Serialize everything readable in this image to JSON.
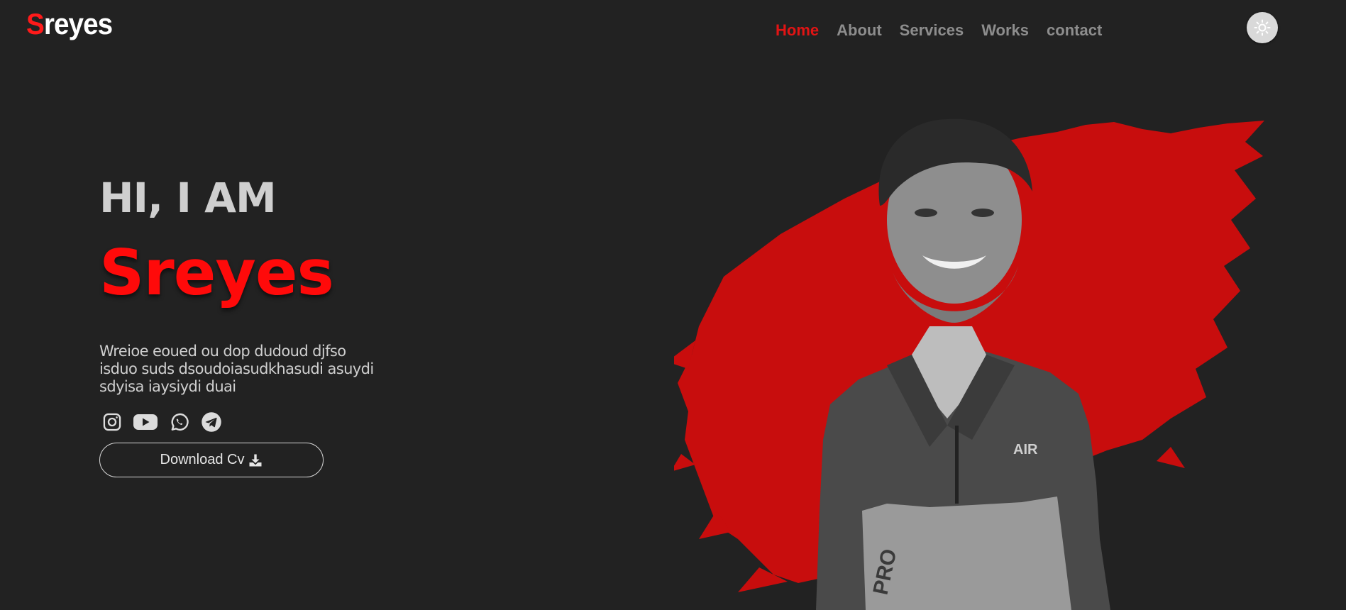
{
  "header": {
    "logo_first": "S",
    "logo_rest": "reyes",
    "nav": [
      {
        "label": "Home",
        "active": true
      },
      {
        "label": "About",
        "active": false
      },
      {
        "label": "Services",
        "active": false
      },
      {
        "label": "Works",
        "active": false
      },
      {
        "label": "contact",
        "active": false
      }
    ],
    "theme_icon": "sun-icon"
  },
  "hero": {
    "greeting": "HI, I AM",
    "name": "Sreyes",
    "description": "Wreioe eoued ou dop dudoud djfso isduo suds dsoudoiasudkhasudi asuydi sdyisa iaysiydi duai",
    "socials": [
      "instagram-icon",
      "youtube-icon",
      "whatsapp-icon",
      "telegram-icon"
    ],
    "cv_button": "Download Cv",
    "cv_icon": "download-icon",
    "photo_text": {
      "shirt": "AIR",
      "sleeve": "PRO"
    }
  },
  "colors": {
    "background": "#222222",
    "accent": "#e11414",
    "brush": "#c80d0d",
    "text": "#cfcfcf",
    "nav_text": "#8d8d8d"
  }
}
